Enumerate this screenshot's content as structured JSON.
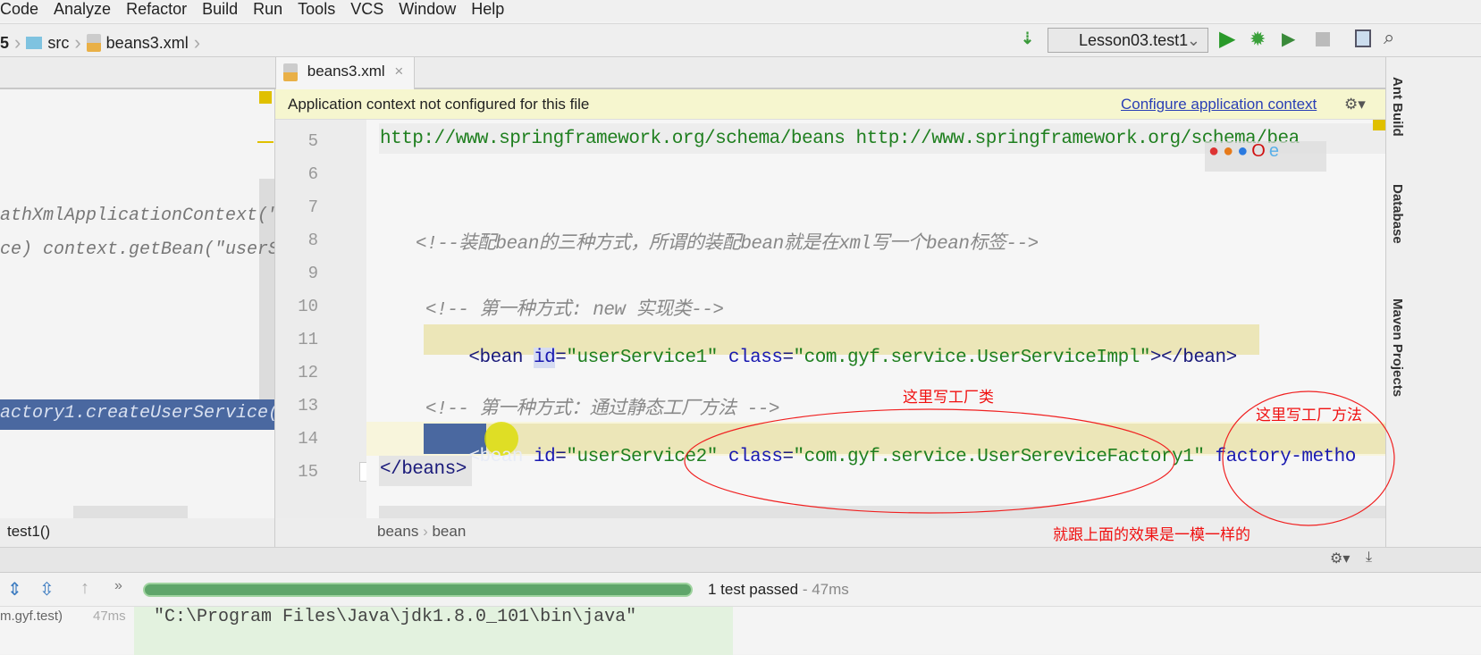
{
  "menu": [
    "Code",
    "Analyze",
    "Refactor",
    "Build",
    "Run",
    "Tools",
    "VCS",
    "Window",
    "Help"
  ],
  "nav": {
    "project_fragment": "5",
    "folder": "src",
    "file": "beans3.xml"
  },
  "toolbar": {
    "run_config": "Lesson03.test1"
  },
  "tab": {
    "label": "beans3.xml"
  },
  "left_pane": {
    "lines": [
      "athXmlApplicationContext(\"",
      "ce) context.getBean(\"userS"
    ],
    "selected_line": "actory1.createUserService(",
    "method": "test1()"
  },
  "notice": {
    "text": "Application context not configured for this file",
    "link": "Configure application context"
  },
  "editor": {
    "lines": [
      {
        "n": "5",
        "text": "http://www.springframework.org/schema/beans http://www.springframework.org/schema/bea"
      },
      {
        "n": "6",
        "text": ""
      },
      {
        "n": "7",
        "text": ""
      },
      {
        "n": "8",
        "text": "<!--装配bean的三种方式，所谓的装配bean就是在xml写一个bean标签-->"
      },
      {
        "n": "9",
        "text": ""
      },
      {
        "n": "10",
        "text": "<!-- 第一种方式: new 实现类-->"
      },
      {
        "n": "11",
        "text": ""
      },
      {
        "n": "12",
        "text": ""
      },
      {
        "n": "13",
        "text": "<!-- 第一种方式：通过静态工厂方法 -->"
      },
      {
        "n": "14",
        "text": ""
      },
      {
        "n": "15",
        "text": ""
      }
    ],
    "line11": {
      "open": "<bean ",
      "id_attr": "id",
      "eq1": "=",
      "id_val": "\"userService1\"",
      "class_attr": " class",
      "eq2": "=",
      "class_val": "\"com.gyf.service.UserServiceImpl\"",
      "close": "></bean>"
    },
    "line14": {
      "open": "<bean ",
      "id_attr": "id",
      "eq1": "=",
      "id_val": "\"userService2\"",
      "class_attr": " class",
      "eq2": "=",
      "class_val": "\"com.gyf.service.UserSereviceFactory1\"",
      "fm_attr": " factory-metho"
    },
    "line15": "</beans>",
    "breadcrumb": [
      "beans",
      "bean"
    ]
  },
  "annotations": {
    "factory_class": "这里写工厂类",
    "factory_method": "这里写工厂方法",
    "same_effect": "就跟上面的效果是一模一样的",
    "color": "#f01010"
  },
  "side_tools": [
    "Ant Build",
    "Database",
    "Maven Projects"
  ],
  "run": {
    "status": "1 test passed",
    "time": " - 47ms",
    "progress": 1.0,
    "tree_item": "m.gyf.test)",
    "tree_time": "47ms",
    "console": "\"C:\\Program Files\\Java\\jdk1.8.0_101\\bin\\java\""
  }
}
